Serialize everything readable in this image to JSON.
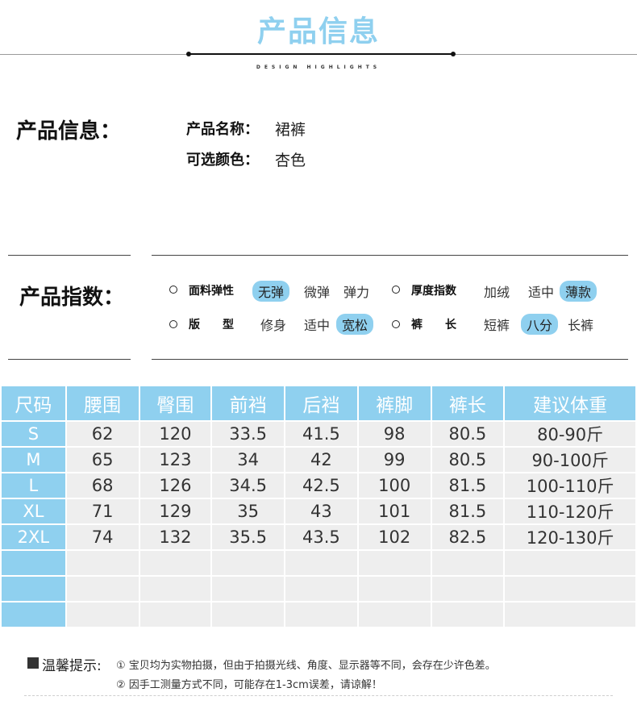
{
  "header": {
    "title": "产品信息",
    "subtitle": "DESIGN HIGHLIGHTS"
  },
  "info": {
    "section_title": "产品信息：",
    "name_label": "产品名称：",
    "name_value": "裙裤",
    "color_label": "可选颜色：",
    "color_value": "杏色"
  },
  "index": {
    "section_title": "产品指数：",
    "rows": [
      {
        "label": "面料弹性",
        "options": [
          "无弹",
          "微弹",
          "弹力"
        ],
        "selected": 0
      },
      {
        "label": "厚度指数",
        "options": [
          "加绒",
          "适中",
          "薄款"
        ],
        "selected": 2
      },
      {
        "label": "版　　型",
        "options": [
          "修身",
          "适中",
          "宽松"
        ],
        "selected": 2
      },
      {
        "label": "裤　　长",
        "options": [
          "短裤",
          "八分",
          "长裤"
        ],
        "selected": 1
      }
    ],
    "accent_color": "#8fd0ef"
  },
  "table": {
    "headers": [
      "尺码",
      "腰围",
      "臀围",
      "前裆",
      "后裆",
      "裤脚",
      "裤长",
      "建议体重"
    ],
    "rows": [
      [
        "S",
        "62",
        "120",
        "33.5",
        "41.5",
        "98",
        "80.5",
        "80-90斤"
      ],
      [
        "M",
        "65",
        "123",
        "34",
        "42",
        "99",
        "80.5",
        "90-100斤"
      ],
      [
        "L",
        "68",
        "126",
        "34.5",
        "42.5",
        "100",
        "81.5",
        "100-110斤"
      ],
      [
        "XL",
        "71",
        "129",
        "35",
        "43",
        "101",
        "81.5",
        "110-120斤"
      ],
      [
        "2XL",
        "74",
        "132",
        "35.5",
        "43.5",
        "102",
        "82.5",
        "120-130斤"
      ]
    ],
    "header_color": "#8fd0ef",
    "cell_color": "#eeeeee"
  },
  "notes": {
    "title": "温馨提示:",
    "items": [
      "① 宝贝均为实物拍摄，但由于拍摄光线、角度、显示器等不同，会存在少许色差。",
      "② 因手工测量方式不同，可能存在1-3cm误差，请谅解！"
    ]
  }
}
